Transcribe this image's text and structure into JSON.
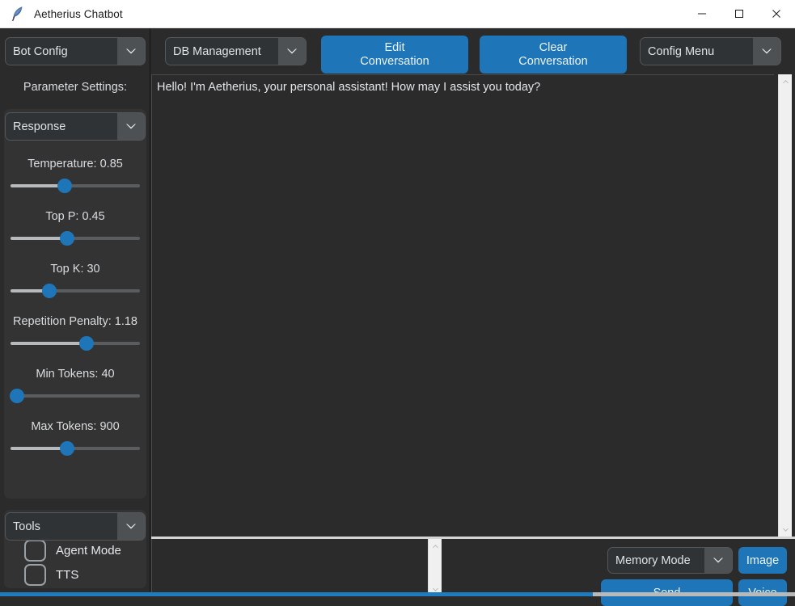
{
  "window": {
    "title": "Aetherius Chatbot",
    "icon": "feather-quill-icon",
    "controls": {
      "minimize": "minimize-icon",
      "maximize": "maximize-icon",
      "close": "close-icon"
    }
  },
  "colors": {
    "accent": "#1e76b8",
    "app_background": "#2b2b2b",
    "panel_background": "#333333",
    "combo_background": "#303336",
    "combo_arrow_background": "#4e5154",
    "text_primary": "#e3e7ea",
    "slider_handle": "#1e76b8",
    "slider_filled": "#b7babd",
    "slider_groove": "#5a5d60",
    "titlebar_background": "#ffffff",
    "splitter": "#d4d4d4",
    "scrollbar": "#f0f0f0"
  },
  "sidebar": {
    "bot_config_combo": {
      "value": "Bot Config",
      "arrow": "chevron-down-icon"
    },
    "parameter_settings_label": "Parameter Settings:",
    "response_combo": {
      "value": "Response",
      "arrow": "chevron-down-icon"
    },
    "sliders": [
      {
        "name": "temperature",
        "label": "Temperature: 0.85",
        "value": 0.85,
        "fill_percent": 42
      },
      {
        "name": "top-p",
        "label": "Top P: 0.45",
        "value": 0.45,
        "fill_percent": 44
      },
      {
        "name": "top-k",
        "label": "Top K: 30",
        "value": 30,
        "fill_percent": 30
      },
      {
        "name": "repetition-penalty",
        "label": "Repetition Penalty: 1.18",
        "value": 1.18,
        "fill_percent": 59
      },
      {
        "name": "min-tokens",
        "label": "Min Tokens: 40",
        "value": 40,
        "fill_percent": 5
      },
      {
        "name": "max-tokens",
        "label": "Max Tokens: 900",
        "value": 900,
        "fill_percent": 44
      }
    ],
    "tools_combo": {
      "value": "Tools",
      "arrow": "chevron-down-icon"
    },
    "checkboxes": [
      {
        "name": "agent-mode",
        "label": "Agent Mode",
        "checked": false
      },
      {
        "name": "tts",
        "label": "TTS",
        "checked": false
      }
    ]
  },
  "toolbar": {
    "db_management_combo": {
      "value": "DB Management",
      "arrow": "chevron-down-icon"
    },
    "edit_conversation": {
      "line1": "Edit",
      "line2": "Conversation"
    },
    "clear_conversation": {
      "line1": "Clear",
      "line2": "Conversation"
    },
    "config_menu_combo": {
      "value": "Config Menu",
      "arrow": "chevron-down-icon"
    }
  },
  "chat": {
    "message": "Hello! I'm Aetherius, your personal assistant! How may I assist you today?",
    "scrollbar": {
      "up": "chevron-up-icon",
      "down": "chevron-down-icon"
    }
  },
  "input": {
    "value": "",
    "placeholder": "",
    "scrollbar": {
      "up": "chevron-up-icon",
      "down": "chevron-down-icon"
    }
  },
  "actions": {
    "memory_mode_combo": {
      "value": "Memory Mode",
      "arrow": "chevron-down-icon"
    },
    "image_label": "Image",
    "send_label": "Send",
    "voice_label": "Voice"
  }
}
